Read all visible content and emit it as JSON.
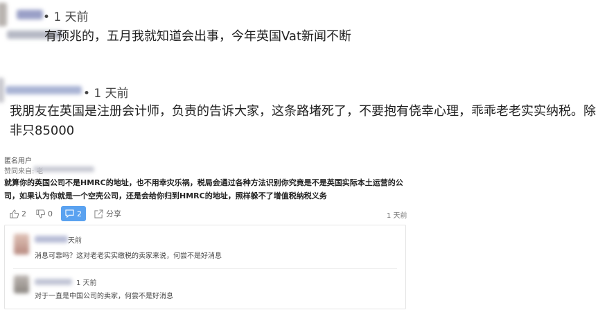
{
  "comment1": {
    "time": "1 天前",
    "text": "有预兆的，五月我就知道会出事，今年英国Vat新闻不断"
  },
  "comment2": {
    "time": "• 1 天前",
    "text": "我朋友在英国是注册会计师，负责的告诉大家，这条路堵死了，不要抱有侥幸心理，乖乖老老实实纳税。除非只85000"
  },
  "post": {
    "author": "匿名用户",
    "via": "赞同来自: 老",
    "body": "就算你的英国公司不是HMRC的地址，也不用幸灾乐祸，税局会通过各种方法识别你究竟是不是英国实际本土运营的公司，如果认为你就是一个空壳公司，还是会给你归到HMRC的地址，照样躲不了增值税纳税义务",
    "likes": "2",
    "dislikes": "0",
    "replies": "2",
    "share_label": "分享",
    "time": "1 天前"
  },
  "replies": [
    {
      "time": "天前",
      "text": "消息可靠吗？这对老老实实缴税的卖家来说，何尝不是好消息"
    },
    {
      "time": "1 天前",
      "text": "对于一直是中国公司的卖家，何尝不是好消息"
    }
  ]
}
